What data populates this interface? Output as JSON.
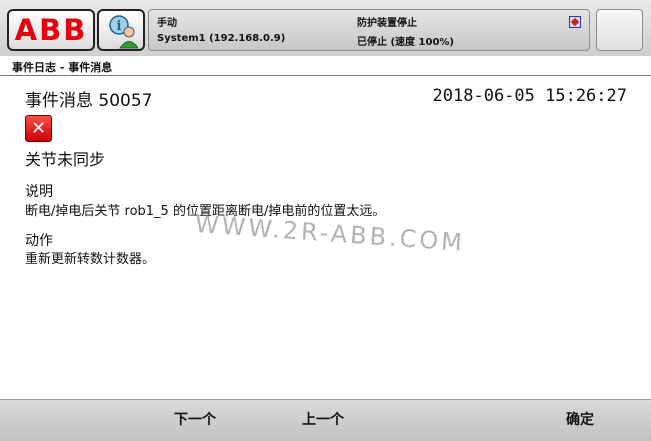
{
  "header": {
    "logo_text": "ABB",
    "mode": "手动",
    "system": "System1 (192.168.0.9)",
    "safety_state": "防护装置停止",
    "run_state": "已停止 (速度 100%)"
  },
  "title_bar": {
    "title": "事件日志 - 事件消息"
  },
  "message": {
    "title": "事件消息 50057",
    "timestamp": "2018-06-05 15:26:27",
    "headline": "关节未同步",
    "description_label": "说明",
    "description": "断电/掉电后关节 rob1_5 的位置距离断电/掉电前的位置太远。",
    "action_label": "动作",
    "action": "重新更新转数计数器。"
  },
  "watermark": "WWW.2R-ABB.COM",
  "footer": {
    "next_label": "下一个",
    "prev_label": "上一个",
    "ok_label": "确定"
  },
  "icons": {
    "error": "error-x-icon",
    "user": "operator-icon",
    "quickset": "quickset-icon"
  },
  "colors": {
    "abb_red": "#e3000f",
    "error_red": "#e01010"
  }
}
